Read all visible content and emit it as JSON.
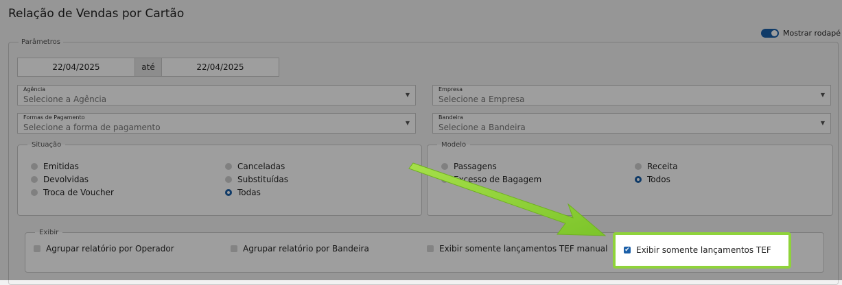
{
  "title": "Relação de Vendas por Cartão",
  "footer_toggle": {
    "label": "Mostrar rodapé",
    "on": true
  },
  "params": {
    "legend": "Parâmetros",
    "date_from": "22/04/2025",
    "date_sep": "até",
    "date_to": "22/04/2025",
    "agencia": {
      "label": "Agência",
      "placeholder": "Selecione a Agência"
    },
    "empresa": {
      "label": "Empresa",
      "placeholder": "Selecione a Empresa"
    },
    "formas": {
      "label": "Formas de Pagamento",
      "placeholder": "Selecione a forma de pagamento"
    },
    "bandeira": {
      "label": "Bandeira",
      "placeholder": "Selecione a Bandeira"
    }
  },
  "situacao": {
    "legend": "Situação",
    "options": [
      "Emitidas",
      "Devolvidas",
      "Troca de Voucher",
      "Canceladas",
      "Substituídas",
      "Todas"
    ],
    "selected": "Todas"
  },
  "modelo": {
    "legend": "Modelo",
    "options": [
      "Passagens",
      "Excesso de Bagagem",
      "Receita",
      "Todos"
    ],
    "selected": "Todos"
  },
  "exibir": {
    "legend": "Exibir",
    "checks": [
      {
        "label": "Agrupar relatório por Operador",
        "checked": false
      },
      {
        "label": "Agrupar relatório por Bandeira",
        "checked": false
      },
      {
        "label": "Exibir somente lançamentos TEF manual",
        "checked": false
      },
      {
        "label": "Exibir somente lançamentos TEF",
        "checked": true
      }
    ]
  },
  "colors": {
    "accent": "#1b5fa8",
    "highlight": "#8fd33a"
  }
}
